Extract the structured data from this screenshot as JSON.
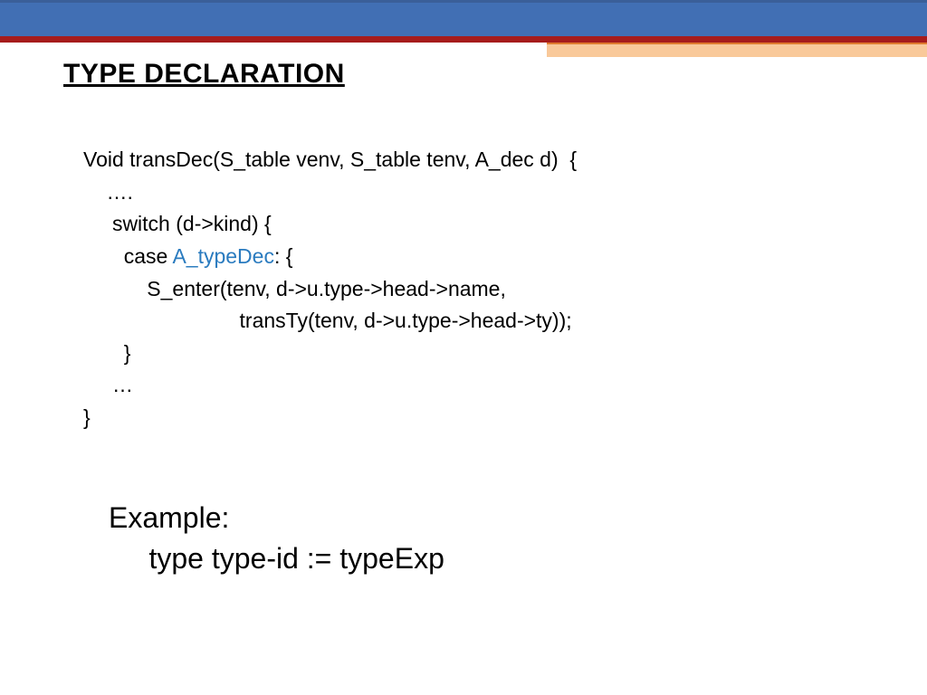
{
  "title": "TYPE DECLARATION",
  "code": {
    "l1": "Void transDec(S_table venv, S_table tenv, A_dec d)  {",
    "l2": "    ….",
    "l3": "     switch (d->kind) {",
    "l4a": "       case ",
    "l4b": "A_typeDec",
    "l4c": ": {",
    "l5": "           S_enter(tenv, d->u.type->head->name,",
    "l6": "                           transTy(tenv, d->u.type->head->ty));",
    "l7": "       }",
    "l8": "     …",
    "l9": "}"
  },
  "example": {
    "l1": "Example:",
    "l2": "     type type-id := typeExp"
  }
}
